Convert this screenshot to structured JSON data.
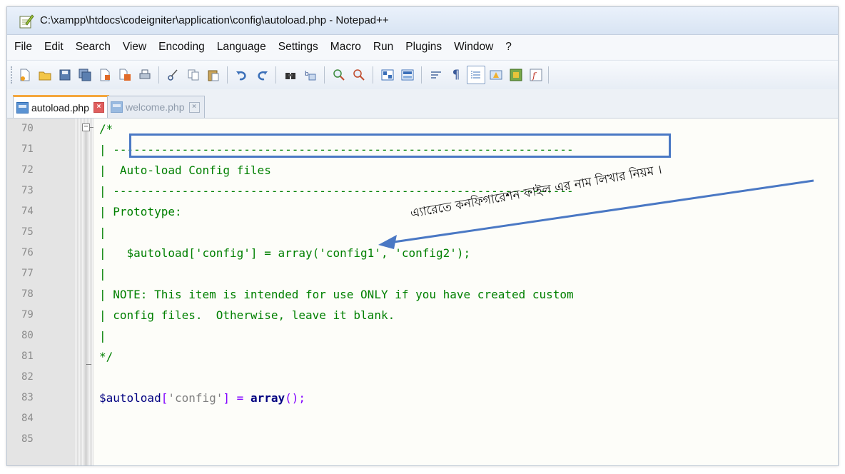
{
  "window": {
    "title": "C:\\xampp\\htdocs\\codeigniter\\application\\config\\autoload.php - Notepad++"
  },
  "menu": {
    "items": [
      "File",
      "Edit",
      "Search",
      "View",
      "Encoding",
      "Language",
      "Settings",
      "Macro",
      "Run",
      "Plugins",
      "Window",
      "?"
    ]
  },
  "toolbar": {
    "buttons": [
      "new-file-icon",
      "open-file-icon",
      "save-icon",
      "save-all-icon",
      "close-icon",
      "close-all-icon",
      "print-icon",
      "cut-icon",
      "copy-icon",
      "paste-icon",
      "undo-icon",
      "redo-icon",
      "find-icon",
      "replace-icon",
      "zoom-in-icon",
      "zoom-out-icon",
      "sync-vertical-icon",
      "sync-horizontal-icon",
      "word-wrap-icon",
      "show-all-characters-icon",
      "indent-guide-icon",
      "user-language-icon",
      "document-map-icon",
      "function-list-icon"
    ]
  },
  "tabs": [
    {
      "label": "autoload.php",
      "active": true
    },
    {
      "label": "welcome.php",
      "active": false
    }
  ],
  "editor": {
    "line_numbers": [
      "70",
      "71",
      "72",
      "73",
      "74",
      "75",
      "76",
      "77",
      "78",
      "79",
      "80",
      "81",
      "82",
      "83",
      "84",
      "85"
    ],
    "lines": {
      "l70": "/*",
      "l71": "| -------------------------------------------------------------------",
      "l72": "|  Auto-load Config files",
      "l73": "| -------------------------------------------------------------------",
      "l74": "| Prototype:",
      "l75": "|",
      "l76": "|   $autoload['config'] = array('config1', 'config2');",
      "l77": "|",
      "l78": "| NOTE: This item is intended for use ONLY if you have created custom",
      "l79": "| config files.  Otherwise, leave it blank.",
      "l80": "|",
      "l81": "*/",
      "l82": "",
      "l83_var": "$autoload",
      "l83_brk1": "[",
      "l83_str": "'config'",
      "l83_brk2": "]",
      "l83_eq": " = ",
      "l83_kw": "array",
      "l83_end": "();",
      "l84": "",
      "l85": ""
    }
  },
  "annotation": {
    "text": "এ্যারেতে কনফিগারেশন ফাইল এর নাম লিখার নিয়ম ।",
    "color": "#4a78c4"
  },
  "colors": {
    "comment": "#008000",
    "keyword": "#000080",
    "string": "#808080",
    "operator": "#8000ff"
  }
}
